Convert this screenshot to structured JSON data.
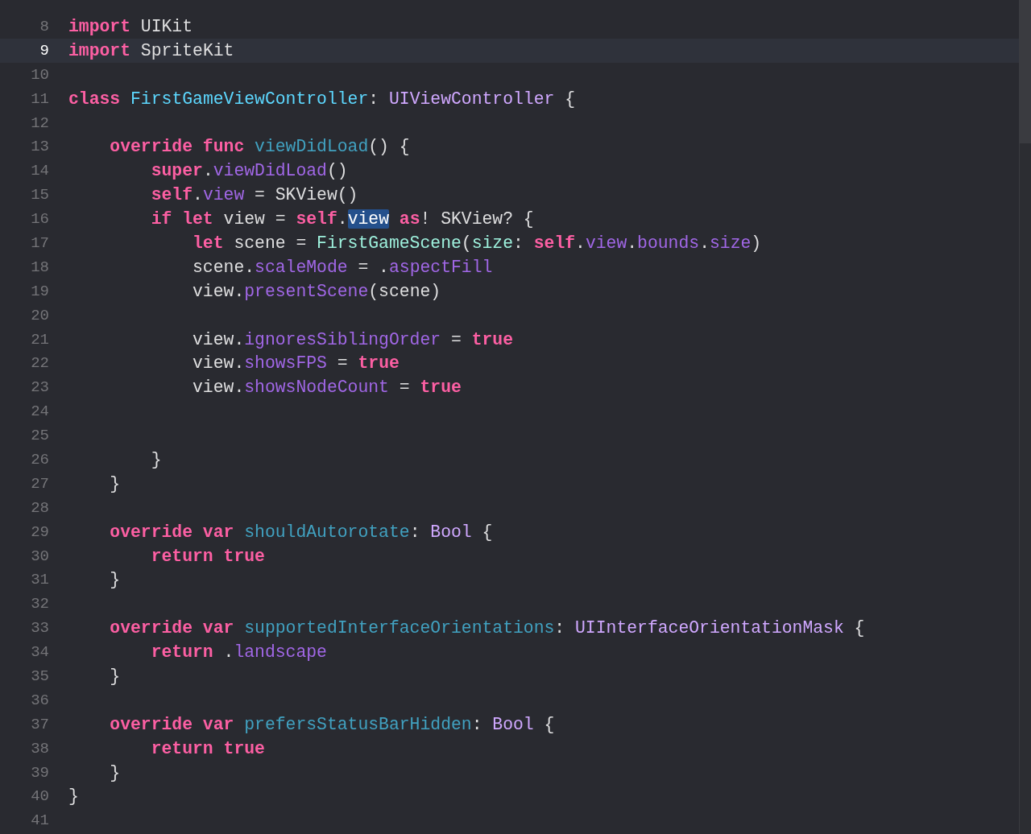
{
  "lines": [
    {
      "number": "8",
      "selected": false,
      "tokens": [
        {
          "kind": "keyword",
          "text": "import "
        },
        {
          "kind": "plain",
          "text": "UIKit"
        }
      ]
    },
    {
      "number": "9",
      "selected": true,
      "tokens": [
        {
          "kind": "keyword",
          "text": "import "
        },
        {
          "kind": "plain",
          "text": "SpriteKit"
        }
      ]
    },
    {
      "number": "10",
      "selected": false
    },
    {
      "number": "11",
      "selected": false,
      "tokens": [
        {
          "kind": "keyword",
          "text": "class "
        },
        {
          "kind": "declared_type",
          "text": "FirstGameViewController"
        },
        {
          "kind": "plain",
          "text": ": "
        },
        {
          "kind": "type",
          "text": "UIViewController"
        },
        {
          "kind": "plain",
          "text": " {"
        }
      ]
    },
    {
      "number": "12",
      "selected": false
    },
    {
      "number": "13",
      "selected": false,
      "tokens": [
        {
          "kind": "keyword",
          "text": "    override func "
        },
        {
          "kind": "declared_member",
          "text": "viewDidLoad"
        },
        {
          "kind": "plain",
          "text": "() {"
        }
      ]
    },
    {
      "number": "14",
      "selected": false,
      "tokens": [
        {
          "kind": "keyword",
          "text": "        super"
        },
        {
          "kind": "plain",
          "text": "."
        },
        {
          "kind": "member",
          "text": "viewDidLoad"
        },
        {
          "kind": "plain",
          "text": "()"
        }
      ]
    },
    {
      "number": "15",
      "selected": false,
      "tokens": [
        {
          "kind": "keyword",
          "text": "        self"
        },
        {
          "kind": "plain",
          "text": "."
        },
        {
          "kind": "member",
          "text": "view"
        },
        {
          "kind": "plain",
          "text": " = SKView()"
        }
      ]
    },
    {
      "number": "16",
      "selected": false,
      "tokens": [
        {
          "kind": "keyword",
          "text": "        if let "
        },
        {
          "kind": "plain",
          "text": "view = "
        },
        {
          "kind": "keyword",
          "text": "self"
        },
        {
          "kind": "plain",
          "text": "."
        },
        {
          "kind": "selection",
          "text": "view"
        },
        {
          "kind": "keyword",
          "text": " as"
        },
        {
          "kind": "plain",
          "text": "! SKView? {"
        }
      ]
    },
    {
      "number": "17",
      "selected": false,
      "tokens": [
        {
          "kind": "keyword",
          "text": "            let "
        },
        {
          "kind": "plain",
          "text": "scene = "
        },
        {
          "kind": "project_type",
          "text": "FirstGameScene"
        },
        {
          "kind": "plain",
          "text": "("
        },
        {
          "kind": "project_type",
          "text": "size"
        },
        {
          "kind": "plain",
          "text": ": "
        },
        {
          "kind": "keyword",
          "text": "self"
        },
        {
          "kind": "plain",
          "text": "."
        },
        {
          "kind": "member",
          "text": "view"
        },
        {
          "kind": "plain",
          "text": "."
        },
        {
          "kind": "member",
          "text": "bounds"
        },
        {
          "kind": "plain",
          "text": "."
        },
        {
          "kind": "member",
          "text": "size"
        },
        {
          "kind": "plain",
          "text": ")"
        }
      ]
    },
    {
      "number": "18",
      "selected": false,
      "tokens": [
        {
          "kind": "plain",
          "text": "            scene."
        },
        {
          "kind": "member",
          "text": "scaleMode"
        },
        {
          "kind": "plain",
          "text": " = ."
        },
        {
          "kind": "member",
          "text": "aspectFill"
        }
      ]
    },
    {
      "number": "19",
      "selected": false,
      "tokens": [
        {
          "kind": "plain",
          "text": "            view."
        },
        {
          "kind": "member",
          "text": "presentScene"
        },
        {
          "kind": "plain",
          "text": "(scene)"
        }
      ]
    },
    {
      "number": "20",
      "selected": false
    },
    {
      "number": "21",
      "selected": false,
      "tokens": [
        {
          "kind": "plain",
          "text": "            view."
        },
        {
          "kind": "member",
          "text": "ignoresSiblingOrder"
        },
        {
          "kind": "plain",
          "text": " = "
        },
        {
          "kind": "keyword",
          "text": "true"
        }
      ]
    },
    {
      "number": "22",
      "selected": false,
      "tokens": [
        {
          "kind": "plain",
          "text": "            view."
        },
        {
          "kind": "member",
          "text": "showsFPS"
        },
        {
          "kind": "plain",
          "text": " = "
        },
        {
          "kind": "keyword",
          "text": "true"
        }
      ]
    },
    {
      "number": "23",
      "selected": false,
      "tokens": [
        {
          "kind": "plain",
          "text": "            view."
        },
        {
          "kind": "member",
          "text": "showsNodeCount"
        },
        {
          "kind": "plain",
          "text": " = "
        },
        {
          "kind": "keyword",
          "text": "true"
        }
      ]
    },
    {
      "number": "24",
      "selected": false
    },
    {
      "number": "25",
      "selected": false
    },
    {
      "number": "26",
      "selected": false,
      "tokens": [
        {
          "kind": "plain",
          "text": "        }"
        }
      ]
    },
    {
      "number": "27",
      "selected": false,
      "tokens": [
        {
          "kind": "plain",
          "text": "    }"
        }
      ]
    },
    {
      "number": "28",
      "selected": false
    },
    {
      "number": "29",
      "selected": false,
      "tokens": [
        {
          "kind": "keyword",
          "text": "    override var "
        },
        {
          "kind": "declared_member",
          "text": "shouldAutorotate"
        },
        {
          "kind": "plain",
          "text": ": "
        },
        {
          "kind": "type",
          "text": "Bool"
        },
        {
          "kind": "plain",
          "text": " {"
        }
      ]
    },
    {
      "number": "30",
      "selected": false,
      "tokens": [
        {
          "kind": "keyword",
          "text": "        return true"
        }
      ]
    },
    {
      "number": "31",
      "selected": false,
      "tokens": [
        {
          "kind": "plain",
          "text": "    }"
        }
      ]
    },
    {
      "number": "32",
      "selected": false
    },
    {
      "number": "33",
      "selected": false,
      "tokens": [
        {
          "kind": "keyword",
          "text": "    override var "
        },
        {
          "kind": "declared_member",
          "text": "supportedInterfaceOrientations"
        },
        {
          "kind": "plain",
          "text": ": "
        },
        {
          "kind": "type",
          "text": "UIInterfaceOrientationMask"
        },
        {
          "kind": "plain",
          "text": " {"
        }
      ]
    },
    {
      "number": "34",
      "selected": false,
      "tokens": [
        {
          "kind": "keyword",
          "text": "        return"
        },
        {
          "kind": "plain",
          "text": " ."
        },
        {
          "kind": "member",
          "text": "landscape"
        }
      ]
    },
    {
      "number": "35",
      "selected": false,
      "tokens": [
        {
          "kind": "plain",
          "text": "    }"
        }
      ]
    },
    {
      "number": "36",
      "selected": false
    },
    {
      "number": "37",
      "selected": false,
      "tokens": [
        {
          "kind": "keyword",
          "text": "    override var "
        },
        {
          "kind": "declared_member",
          "text": "prefersStatusBarHidden"
        },
        {
          "kind": "plain",
          "text": ": "
        },
        {
          "kind": "type",
          "text": "Bool"
        },
        {
          "kind": "plain",
          "text": " {"
        }
      ]
    },
    {
      "number": "38",
      "selected": false,
      "tokens": [
        {
          "kind": "keyword",
          "text": "        return true"
        }
      ]
    },
    {
      "number": "39",
      "selected": false,
      "tokens": [
        {
          "kind": "plain",
          "text": "    }"
        }
      ]
    },
    {
      "number": "40",
      "selected": false,
      "tokens": [
        {
          "kind": "plain",
          "text": "}"
        }
      ]
    },
    {
      "number": "41",
      "selected": false
    }
  ]
}
